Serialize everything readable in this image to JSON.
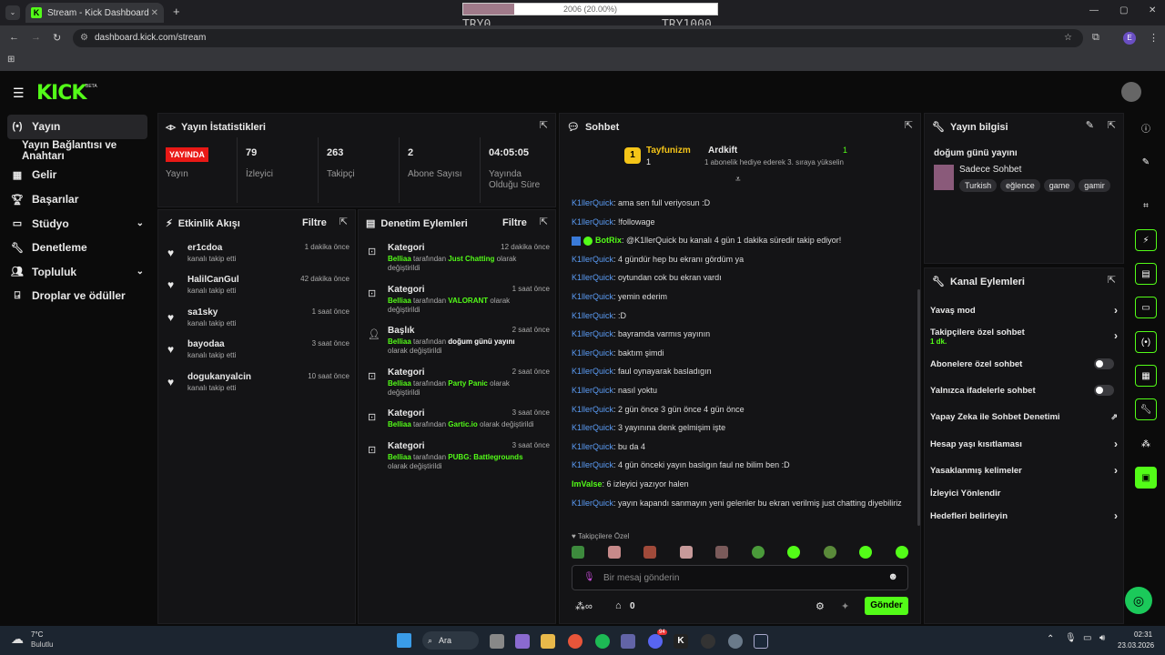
{
  "browser": {
    "tab_title": "Stream - Kick Dashboard",
    "url": "dashboard.kick.com/stream",
    "profile": "E"
  },
  "overlay": {
    "bar_text": "2006 (20.00%)",
    "progress": 0.2,
    "left_label": "TRY0",
    "right_label": "TRY1000"
  },
  "app": {
    "logo": "KICK",
    "beta": "BETA"
  },
  "sidebar": {
    "items": [
      {
        "label": "Yayın",
        "icon": "broadcast-icon"
      },
      {
        "label": "Yayın Bağlantısı ve Anahtarı"
      },
      {
        "label": "Gelir",
        "icon": "dollar-icon"
      },
      {
        "label": "Başarılar",
        "icon": "trophy-icon"
      },
      {
        "label": "Stüdyo",
        "icon": "studio-icon"
      },
      {
        "label": "Denetleme",
        "icon": "wrench-icon"
      },
      {
        "label": "Topluluk",
        "icon": "people-icon"
      },
      {
        "label": "Droplar ve ödüller",
        "icon": "gift-icon"
      }
    ]
  },
  "stats": {
    "title": "Yayın İstatistikleri",
    "live_badge": "YAYINDA",
    "live_label": "Yayın",
    "viewers": {
      "value": "79",
      "label": "İzleyici"
    },
    "followers": {
      "value": "263",
      "label": "Takipçi"
    },
    "subs": {
      "value": "2",
      "label": "Abone Sayısı"
    },
    "uptime": {
      "value": "04:05:05",
      "label": "Yayında Olduğu Süre"
    }
  },
  "events": {
    "title": "Etkinlik Akışı",
    "filter": "Filtre",
    "items": [
      {
        "name": "er1cdoa",
        "sub": "kanalı takip etti",
        "time": "1 dakika önce"
      },
      {
        "name": "HalilCanGul",
        "sub": "kanalı takip etti",
        "time": "42 dakika önce"
      },
      {
        "name": "sa1sky",
        "sub": "kanalı takip etti",
        "time": "1 saat önce"
      },
      {
        "name": "bayodaa",
        "sub": "kanalı takip etti",
        "time": "3 saat önce"
      },
      {
        "name": "dogukanyalcin",
        "sub": "kanalı takip etti",
        "time": "10 saat önce"
      }
    ]
  },
  "mod_actions": {
    "title": "Denetim Eylemleri",
    "filter": "Filtre",
    "by_word": "tarafından",
    "changed": "olarak değiştirildi",
    "items": [
      {
        "type": "Kategori",
        "user": "Belliaa",
        "value": "Just Chatting",
        "time": "12 dakika önce"
      },
      {
        "type": "Kategori",
        "user": "Belliaa",
        "value": "VALORANT",
        "time": "1 saat önce"
      },
      {
        "type": "Başlık",
        "user": "Belliaa",
        "value": "doğum günü yayını",
        "time": "2 saat önce"
      },
      {
        "type": "Kategori",
        "user": "Belliaa",
        "value": "Party Panic",
        "time": "2 saat önce"
      },
      {
        "type": "Kategori",
        "user": "Belliaa",
        "value": "Gartic.io",
        "time": "3 saat önce"
      },
      {
        "type": "Kategori",
        "user": "Belliaa",
        "value": "PUBG: Battlegrounds",
        "time": "3 saat önce"
      }
    ]
  },
  "chat": {
    "title": "Sohbet",
    "gift_rank": "1",
    "gifter1": "Tayfunizm",
    "gifter1_count": "1",
    "gifter2": "Ardkift",
    "gifter2_count": "1",
    "gift_note": "1 abonelik hediye ederek 3. sıraya yükselin",
    "messages": [
      {
        "user": "K1llerQuick",
        "text": "ama sen full veriyosun :D"
      },
      {
        "user": "K1llerQuick",
        "text": "!followage"
      },
      {
        "user": "BotRix",
        "text": "@K1llerQuick bu kanalı 4 gün 1 dakika süredir takip ediyor!",
        "bot": true
      },
      {
        "user": "K1llerQuick",
        "text": "4 gündür hep bu ekranı gördüm ya"
      },
      {
        "user": "K1llerQuick",
        "text": "oytundan cok bu ekran vardı"
      },
      {
        "user": "K1llerQuick",
        "text": "yemin ederim"
      },
      {
        "user": "K1llerQuick",
        "text": ":D"
      },
      {
        "user": "K1llerQuick",
        "text": "bayramda varmıs yayının"
      },
      {
        "user": "K1llerQuick",
        "text": "baktım şimdi"
      },
      {
        "user": "K1llerQuick",
        "text": "faul oynayarak basladıgın"
      },
      {
        "user": "K1llerQuick",
        "text": "nasıl yoktu"
      },
      {
        "user": "K1llerQuick",
        "text": "2 gün önce 3 gün önce 4 gün önce"
      },
      {
        "user": "K1llerQuick",
        "text": "3 yayınına denk gelmişim işte"
      },
      {
        "user": "K1llerQuick",
        "text": "bu da 4"
      },
      {
        "user": "K1llerQuick",
        "text": "4 gün önceki yayın baslıgın faul ne bilim ben :D"
      },
      {
        "user": "ImValse",
        "text": "6 izleyici yazıyor halen",
        "green": true
      },
      {
        "user": "K1llerQuick",
        "text": "yayın kapandı sanmayın yeni gelenler bu ekran verilmiş just chatting diyebiliriz"
      }
    ],
    "followers_only": "Takipçilere Özel",
    "placeholder": "Bir mesaj gönderin",
    "points": "0",
    "send": "Gönder"
  },
  "stream_info": {
    "title": "Yayın bilgisi",
    "stream_title": "doğum günü yayını",
    "category": "Sadece Sohbet",
    "tags": [
      "Turkish",
      "eğlence",
      "game",
      "gamir"
    ]
  },
  "channel_actions": {
    "title": "Kanal Eylemleri",
    "slow_mode": "Yavaş mod",
    "followers_chat": "Takipçilere özel sohbet",
    "followers_chat_value": "1 dk.",
    "subs_chat": "Abonelere özel sohbet",
    "emote_chat": "Yalnızca ifadelerle sohbet",
    "ai_mod": "Yapay Zeka ile Sohbet Denetimi",
    "age_limit": "Hesap yaşı kısıtlaması",
    "banned_words": "Yasaklanmış kelimeler",
    "redirect": "İzleyici Yönlendir",
    "goals": "Hedefleri belirleyin"
  },
  "taskbar": {
    "temp": "7°C",
    "weather": "Bulutlu",
    "search": "Ara",
    "time": "02:31",
    "date": "23.03.2026",
    "discord_badge": "94"
  }
}
